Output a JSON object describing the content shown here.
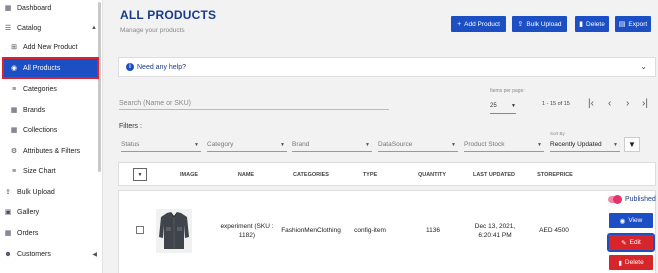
{
  "sidebar": {
    "items": [
      {
        "label": "Dashboard",
        "icon": "dashboard-icon"
      },
      {
        "label": "Catalog",
        "icon": "catalog-icon"
      },
      {
        "label": "Add New Product",
        "icon": "plus-square-icon"
      },
      {
        "label": "All Products",
        "icon": "eye-icon"
      },
      {
        "label": "Categories",
        "icon": "list-icon"
      },
      {
        "label": "Brands",
        "icon": "grid-icon"
      },
      {
        "label": "Collections",
        "icon": "grid-icon"
      },
      {
        "label": "Attributes & Filters",
        "icon": "sliders-icon"
      },
      {
        "label": "Size Chart",
        "icon": "list-icon"
      },
      {
        "label": "Bulk Upload",
        "icon": "upload-icon"
      },
      {
        "label": "Gallery",
        "icon": "image-icon"
      },
      {
        "label": "Orders",
        "icon": "grid-icon"
      },
      {
        "label": "Customers",
        "icon": "users-icon"
      }
    ]
  },
  "header": {
    "title": "ALL PRODUCTS",
    "subtitle": "Manage your products",
    "buttons": {
      "add": "Add Product",
      "bulk": "Bulk Upload",
      "delete": "Delete",
      "export": "Export"
    }
  },
  "help": {
    "label": "Need any help?"
  },
  "search": {
    "placeholder": "Search (Name or SKU)"
  },
  "pagination": {
    "items_per_page_label": "Items per page:",
    "items_per_page": "25",
    "range": "1 - 15 of 15"
  },
  "filters": {
    "label": "Filters :",
    "status": "Status",
    "category": "Category",
    "brand": "Brand",
    "datasource": "DataSource",
    "stock": "Product Stock",
    "sort_by_label": "Sort By",
    "sort_by": "Recently Updated"
  },
  "table": {
    "columns": {
      "image": "IMAGE",
      "name": "NAME",
      "categories": "CATEGORIES",
      "type": "TYPE",
      "quantity": "QUANTITY",
      "last_updated": "LAST UPDATED",
      "storeprice": "STOREPRICE"
    },
    "rows": [
      {
        "name_line1": "experiment (SKU :",
        "name_line2": "1182)",
        "categories": "FashionMenClothing",
        "type": "config-item",
        "quantity": "1136",
        "updated_line1": "Dec 13, 2021,",
        "updated_line2": "6:20:41 PM",
        "storeprice": "AED 4500",
        "status": "Published",
        "view": "View",
        "edit": "Edit",
        "delete": "Delete"
      }
    ]
  },
  "colors": {
    "primary": "#1d4fc4",
    "danger": "#d6262b",
    "title": "#1a3a8a",
    "toggle": "#e8326a"
  }
}
